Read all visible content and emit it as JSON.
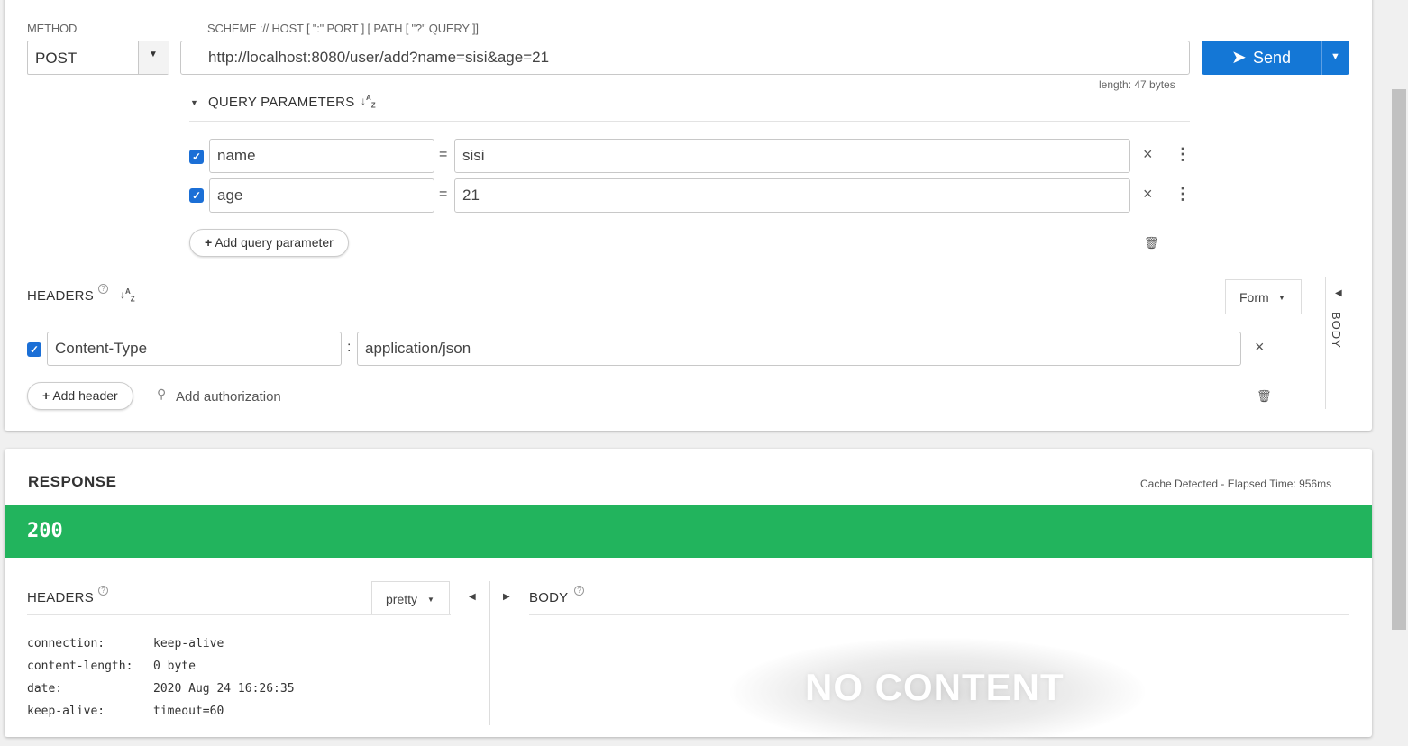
{
  "request": {
    "method_label": "METHOD",
    "method_value": "POST",
    "url_label": "SCHEME :// HOST [ \":\" PORT ] [ PATH [ \"?\" QUERY ]]",
    "url_value": "http://localhost:8080/user/add?name=sisi&age=21",
    "length_text": "length: 47 bytes",
    "send_label": "Send",
    "query": {
      "title": "QUERY PARAMETERS",
      "params": [
        {
          "key": "name",
          "value": "sisi"
        },
        {
          "key": "age",
          "value": "21"
        }
      ],
      "add_label": "Add query parameter",
      "eq": "="
    },
    "headers": {
      "title": "HEADERS",
      "mode": "Form",
      "items": [
        {
          "key": "Content-Type",
          "value": "application/json"
        }
      ],
      "colon": ":",
      "add_label": "Add header",
      "auth_label": "Add authorization"
    },
    "body_tab": "BODY"
  },
  "response": {
    "title": "RESPONSE",
    "cache_text": "Cache Detected - Elapsed Time: 956ms",
    "status": "200",
    "status_color": "#22b45d",
    "headers_title": "HEADERS",
    "headers_mode": "pretty",
    "body_title": "BODY",
    "no_content": "NO CONTENT",
    "headers": [
      {
        "name": "connection:",
        "value": "keep-alive"
      },
      {
        "name": "content-length:",
        "value": "0 byte"
      },
      {
        "name": "date:",
        "value": "2020 Aug 24 16:26:35"
      },
      {
        "name": "keep-alive:",
        "value": "timeout=60"
      }
    ]
  },
  "colors": {
    "accent": "#1b6fd6",
    "send": "#1477d6"
  }
}
